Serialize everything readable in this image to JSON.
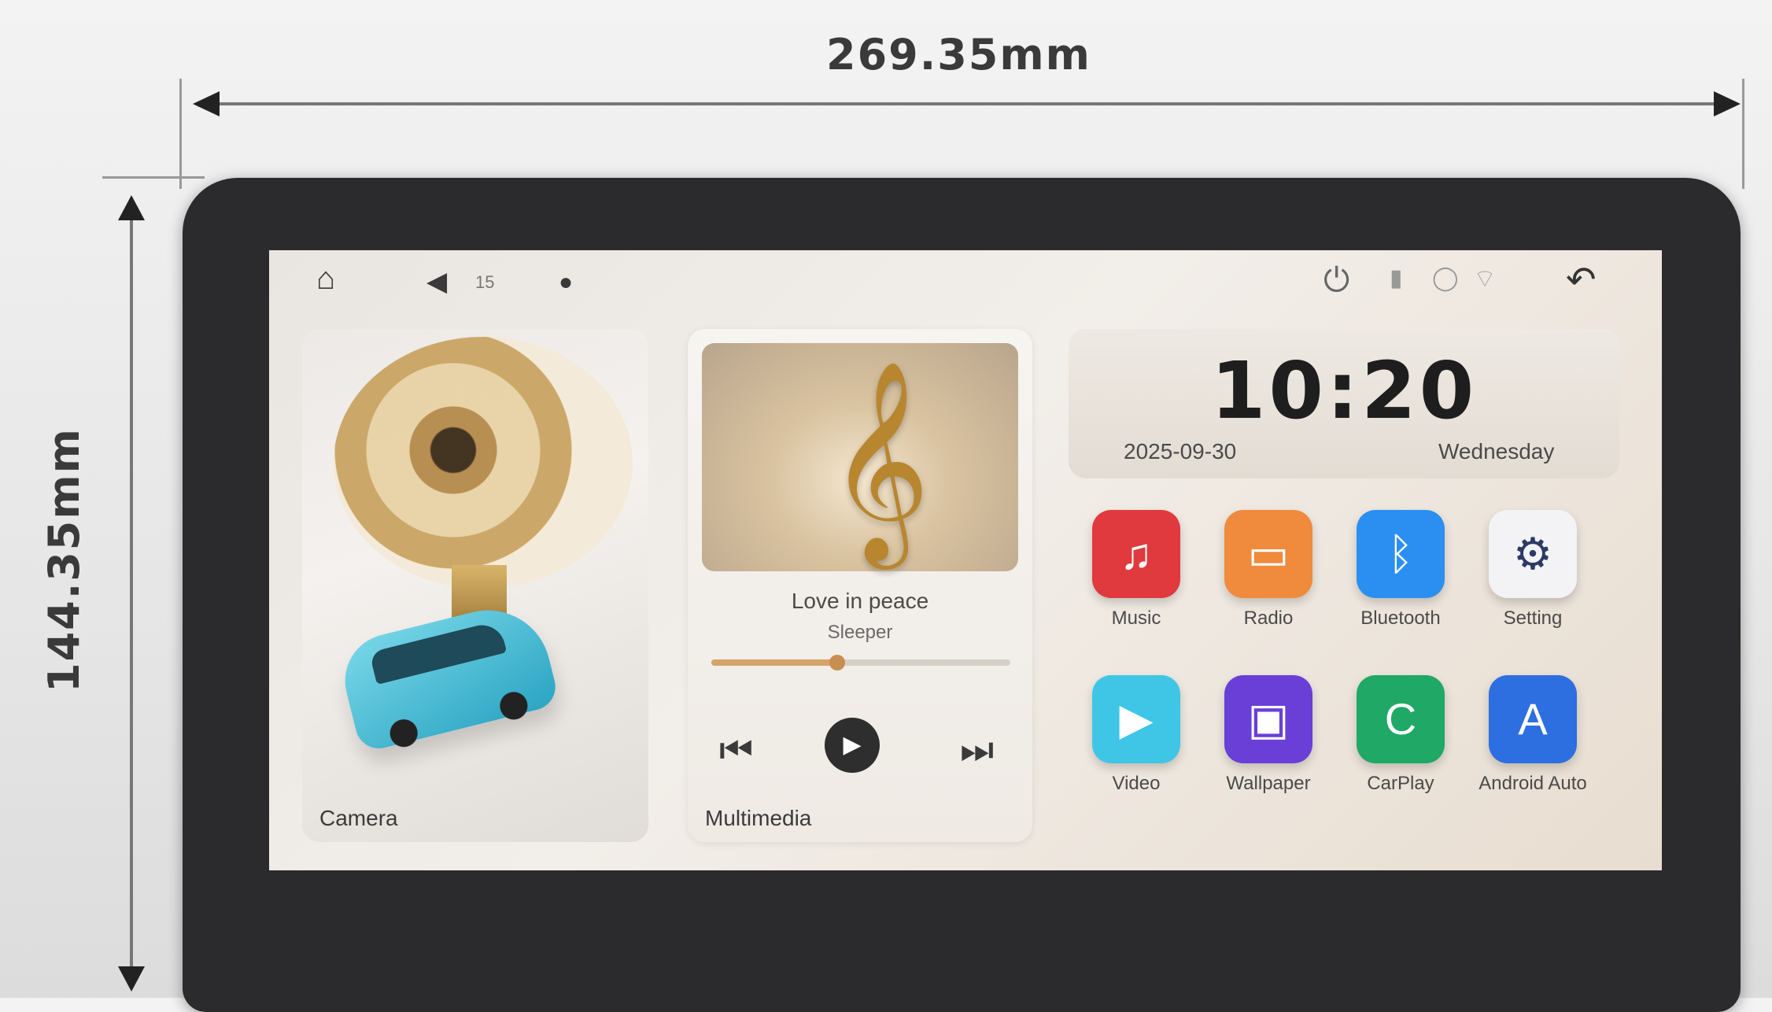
{
  "dimensions": {
    "width_label": "269.35mm",
    "height_label": "144.35mm"
  },
  "status_bar": {
    "home_icon": "home-icon",
    "volume_icon": "volume-icon",
    "volume_value": "15",
    "power_icon": "power-icon",
    "back_icon": "back-icon"
  },
  "camera_card": {
    "label": "Camera"
  },
  "media_card": {
    "label": "Multimedia",
    "song_title": "Love in peace",
    "artist": "Sleeper",
    "progress": 0.42
  },
  "clock": {
    "time": "10:20",
    "date": "2025-09-30",
    "weekday": "Wednesday"
  },
  "apps": [
    {
      "label": "Music",
      "icon": "music-note-icon",
      "color": "#e0393e",
      "glyph": "♫"
    },
    {
      "label": "Radio",
      "icon": "radio-icon",
      "color": "#f08a3c",
      "glyph": "▭"
    },
    {
      "label": "Bluetooth",
      "icon": "bluetooth-icon",
      "color": "#2a8ff0",
      "glyph": "ᛒ"
    },
    {
      "label": "Setting",
      "icon": "gear-icon",
      "color": "#f3f3f5",
      "glyph": "⚙"
    },
    {
      "label": "Video",
      "icon": "play-icon",
      "color": "#3fc6e6",
      "glyph": "▶"
    },
    {
      "label": "Wallpaper",
      "icon": "image-icon",
      "color": "#6a3fd8",
      "glyph": "▣"
    },
    {
      "label": "CarPlay",
      "icon": "carplay-icon",
      "color": "#1fa866",
      "glyph": "C"
    },
    {
      "label": "Android Auto",
      "icon": "android-auto-icon",
      "color": "#2d6fe0",
      "glyph": "A"
    }
  ]
}
